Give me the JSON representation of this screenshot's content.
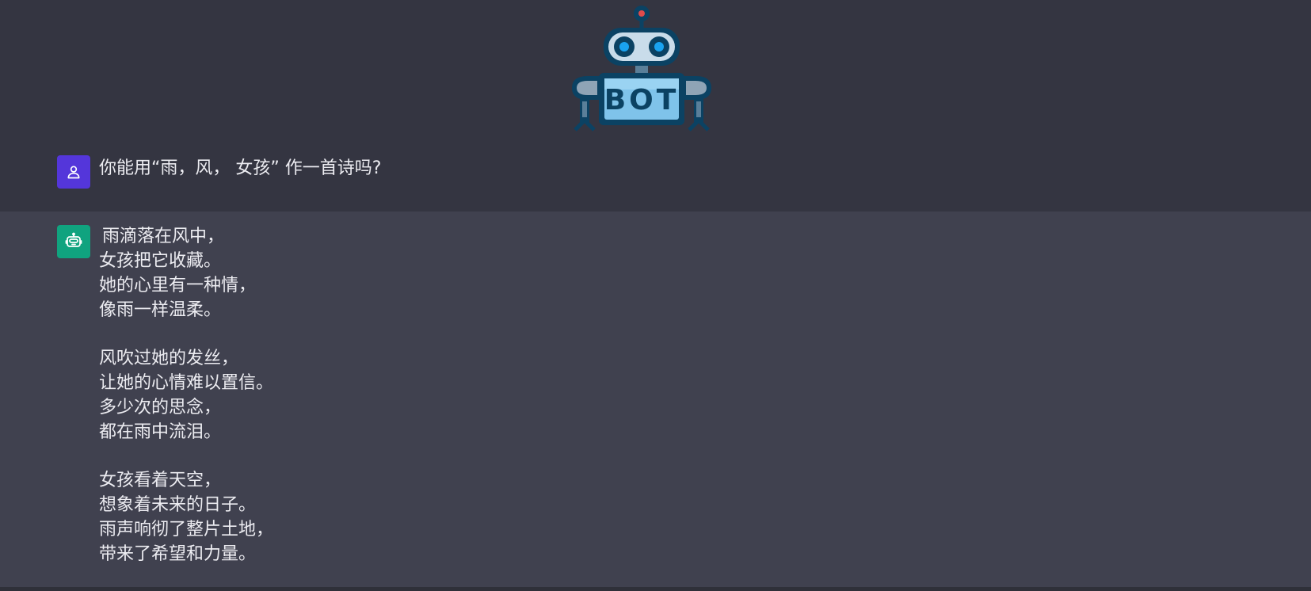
{
  "hero": {
    "logo_text": "BOT"
  },
  "user_message": {
    "text": "你能用“雨，风， 女孩” 作一首诗吗?"
  },
  "bot_message": {
    "stanzas": [
      [
        "雨滴落在风中，",
        "女孩把它收藏。",
        "她的心里有一种情，",
        "像雨一样温柔。"
      ],
      [
        "风吹过她的发丝，",
        "让她的心情难以置信。",
        "多少次的思念，",
        "都在雨中流泪。"
      ],
      [
        "女孩看着天空，",
        "想象着未来的日子。",
        "雨声响彻了整片土地，",
        "带来了希望和力量。"
      ]
    ]
  },
  "colors": {
    "background": "#343541",
    "bot_row_background": "#40414f",
    "user_avatar": "#5436da",
    "bot_avatar": "#10a37f",
    "text": "#ececf1"
  }
}
